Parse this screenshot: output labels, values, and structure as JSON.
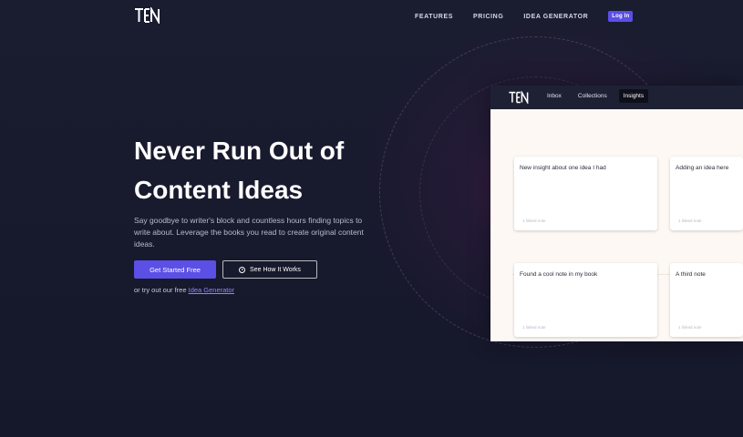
{
  "nav": {
    "items": [
      {
        "label": "FEATURES"
      },
      {
        "label": "PRICING"
      },
      {
        "label": "IDEA GENERATOR"
      }
    ],
    "login_label": "Log In"
  },
  "hero": {
    "title_line1": "Never Run Out of",
    "title_line2": "Content Ideas",
    "subtitle": "Say goodbye to writer's block and countless hours finding topics to write about. Leverage the books you read to create original content ideas.",
    "cta_primary": "Get Started Free",
    "cta_secondary": "See How It Works",
    "try_prefix": "or try out our free ",
    "try_link": "Idea Generator"
  },
  "preview": {
    "tabs": [
      {
        "label": "Inbox",
        "active": false
      },
      {
        "label": "Collections",
        "active": false
      },
      {
        "label": "Insights",
        "active": true
      }
    ],
    "cards": [
      {
        "title": "New insight about one idea I had",
        "footer": "1 linked note"
      },
      {
        "title": "Adding an idea here",
        "footer": "1 linked note"
      },
      {
        "title": "Found a cool note in my book",
        "footer": "1 linked note"
      },
      {
        "title": "A third note",
        "footer": "1 linked note"
      }
    ]
  },
  "colors": {
    "background": "#161829",
    "accent": "#5b4fe6",
    "link": "#8f86ff",
    "preview_body": "#fdf8f3"
  },
  "icons": [
    "logo-icon",
    "play-circle-icon"
  ]
}
